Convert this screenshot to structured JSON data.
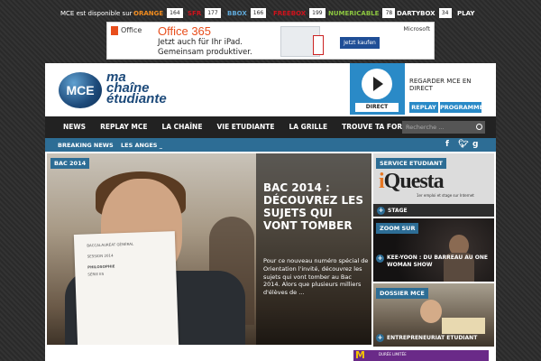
{
  "topbar": {
    "lead": "MCE est disponible sur :",
    "providers": [
      {
        "name": "ORANGE",
        "number": "164",
        "color": "#f28c1e"
      },
      {
        "name": "SFR",
        "number": "177",
        "color": "#d0121b"
      },
      {
        "name": "BBOX",
        "number": "166",
        "color": "#5fa8d8"
      },
      {
        "name": "FREEBOX",
        "number": "199",
        "color": "#d0121b"
      },
      {
        "name": "NUMERICABLE",
        "number": "78",
        "color": "#8cc63f"
      },
      {
        "name": "DARTYBOX",
        "number": "34",
        "color": "#ffffff"
      },
      {
        "name": "PLAY",
        "number": "",
        "color": "#ffffff"
      }
    ]
  },
  "ad": {
    "small_brand": "Office",
    "product": "Office 365",
    "line1": "Jetzt auch für Ihr iPad.",
    "line2": "Gemeinsam produktiver.",
    "cta": "Jetzt kaufen",
    "brand": "Microsoft"
  },
  "header": {
    "logo_mark": "MCE",
    "logo_lines": [
      "ma",
      "chaîne",
      "étudiante"
    ],
    "live_label": "DIRECT",
    "watch_live": "REGARDER MCE EN DIRECT",
    "buttons": [
      "REPLAY",
      "PROGRAMME"
    ]
  },
  "nav": {
    "items": [
      "NEWS",
      "REPLAY MCE",
      "LA CHAÎNE",
      "VIE ETUDIANTE",
      "LA GRILLE",
      "TROUVE TA FORMATION"
    ],
    "search_placeholder": "Recherche ..."
  },
  "breaking": {
    "label": "BREAKING NEWS",
    "value": "LES ANGES _"
  },
  "hero": {
    "tag": "BAC 2014",
    "title": "BAC 2014 : DÉCOUVREZ LES SUJETS QUI VONT TOMBER",
    "description": "Pour ce nouveau numéro spécial de Orientation l'invité, découvrez les sujets qui vont tomber au Bac 2014. Alors que plusieurs milliers d'élèves de ..."
  },
  "cards": [
    {
      "tag": "SERVICE ETUDIANT",
      "caption": "STAGE",
      "brand": "iQuesta",
      "brand_sub": "1er emploi et stage sur Internet"
    },
    {
      "tag": "ZOOM SUR",
      "caption": "KEE-YOON : DU BARREAU AU ONE WOMAN SHOW"
    },
    {
      "tag": "DOSSIER MCE",
      "caption": "ENTREPRENEURIAT ETUDIANT"
    }
  ],
  "bottom_ad": {
    "mark": "M",
    "text": "DURÉE LIMITÉE"
  },
  "colors": {
    "accent": "#2d6d95",
    "nav_bg": "#222222",
    "live_blue": "#2a8ac7"
  }
}
